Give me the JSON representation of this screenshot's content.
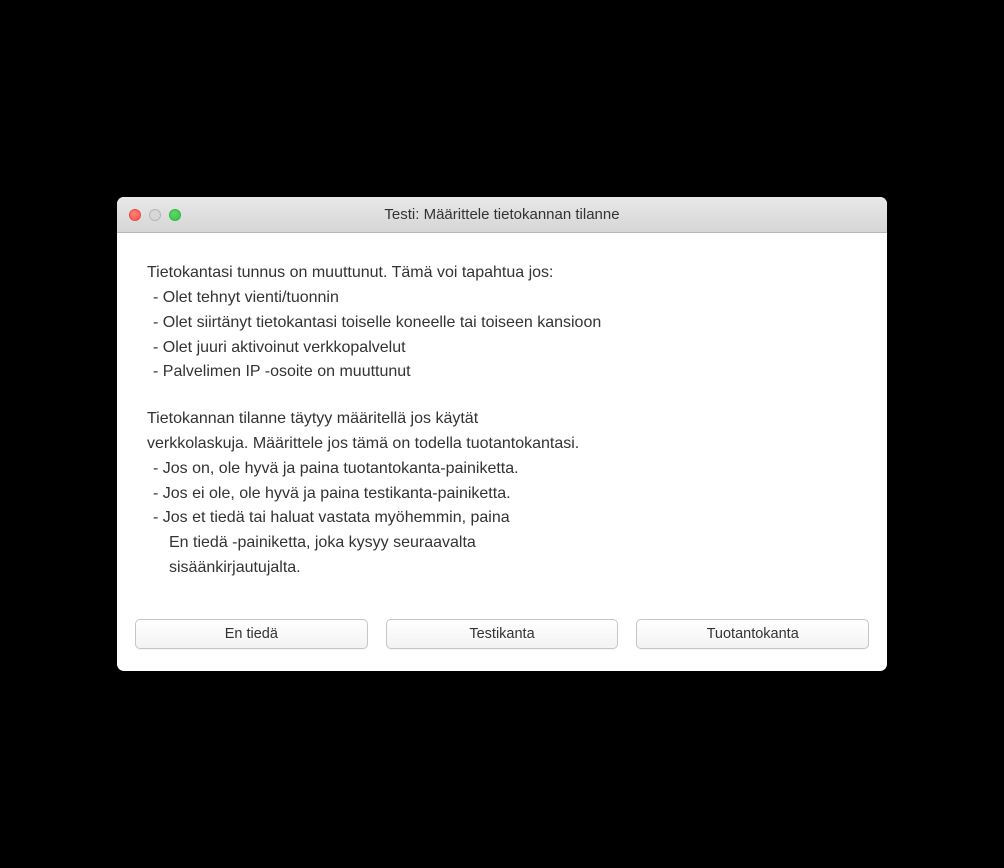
{
  "window": {
    "title": "Testi: Määrittele tietokannan tilanne"
  },
  "content": {
    "intro1": "Tietokantasi tunnus on muuttunut. Tämä voi tapahtua jos:",
    "bullets1": [
      " - Olet tehnyt vienti/tuonnin",
      " - Olet siirtänyt tietokantasi toiselle koneelle tai toiseen kansioon",
      " - Olet juuri aktivoinut verkkopalvelut",
      " - Palvelimen IP -osoite on muuttunut"
    ],
    "intro2a": "Tietokannan tilanne täytyy määritellä jos käytät",
    "intro2b": "verkkolaskuja. Määrittele jos tämä on todella tuotantokantasi.",
    "bullets2": [
      " - Jos on, ole hyvä ja paina tuotantokanta-painiketta.",
      " - Jos ei ole, ole hyvä ja paina testikanta-painiketta.",
      " - Jos et tiedä tai haluat vastata myöhemmin, paina"
    ],
    "sub1": "En tiedä -painiketta, joka kysyy seuraavalta",
    "sub2": "sisäänkirjautujalta."
  },
  "buttons": {
    "dont_know": "En tiedä",
    "test_db": "Testikanta",
    "prod_db": "Tuotantokanta"
  }
}
